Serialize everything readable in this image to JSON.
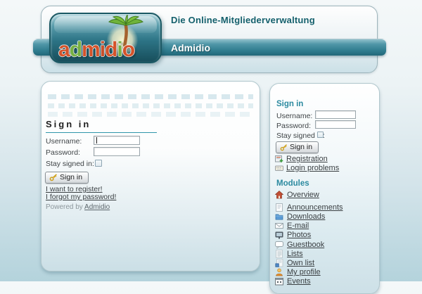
{
  "header": {
    "tagline": "Die Online-Mitgliederverwaltung",
    "app_name": "Admidio",
    "logo_word": "admidio",
    "logo_letters": [
      {
        "ch": "a",
        "color": "#d4532a"
      },
      {
        "ch": "d",
        "color": "#76b043"
      },
      {
        "ch": "m",
        "color": "#d4532a"
      },
      {
        "ch": "i",
        "color": "#c9502b"
      },
      {
        "ch": "d",
        "color": "#d4532a"
      },
      {
        "ch": "i",
        "color": "#76b043"
      },
      {
        "ch": "o",
        "color": "#d4532a"
      }
    ]
  },
  "login_form": {
    "title": "Sign in",
    "username_label": "Username:",
    "username_value": "",
    "password_label": "Password:",
    "password_value": "",
    "stay_signed_in_label": "Stay signed in:",
    "stay_signed_in_checked": false,
    "sign_in_button": "Sign in",
    "register_link": "I want to register!",
    "forgot_password_link": "I forgot my password!",
    "powered_by": "Powered by",
    "powered_by_link": "Admidio"
  },
  "sidebar": {
    "signin": {
      "title": "Sign in",
      "username_label": "Username:",
      "username_value": "",
      "password_label": "Password:",
      "password_value": "",
      "stay_signed_in_label": "Stay signed in:",
      "stay_signed_in_checked": false,
      "sign_in_button": "Sign in",
      "registration_link": "Registration",
      "login_problems_link": "Login problems"
    },
    "modules_title": "Modules",
    "modules": [
      {
        "label": "Overview",
        "icon": "house-icon"
      },
      {
        "label": "Announcements",
        "icon": "announcement-icon"
      },
      {
        "label": "Downloads",
        "icon": "folder-icon"
      },
      {
        "label": "E-mail",
        "icon": "envelope-icon"
      },
      {
        "label": "Photos",
        "icon": "photo-icon"
      },
      {
        "label": "Guestbook",
        "icon": "speech-bubble-icon"
      },
      {
        "label": "Lists",
        "icon": "list-icon"
      },
      {
        "label": "Own list",
        "icon": "own-list-icon"
      },
      {
        "label": "My profile",
        "icon": "person-icon"
      },
      {
        "label": "Events",
        "icon": "calendar-icon"
      }
    ]
  },
  "colors": {
    "teal_bar": "#2f7c8e",
    "accent_teal": "#2c8aa0",
    "logo_orange": "#d4532a",
    "logo_green": "#76b043",
    "link": "#3a3f42",
    "page_bottom": "#b4d3dc"
  }
}
